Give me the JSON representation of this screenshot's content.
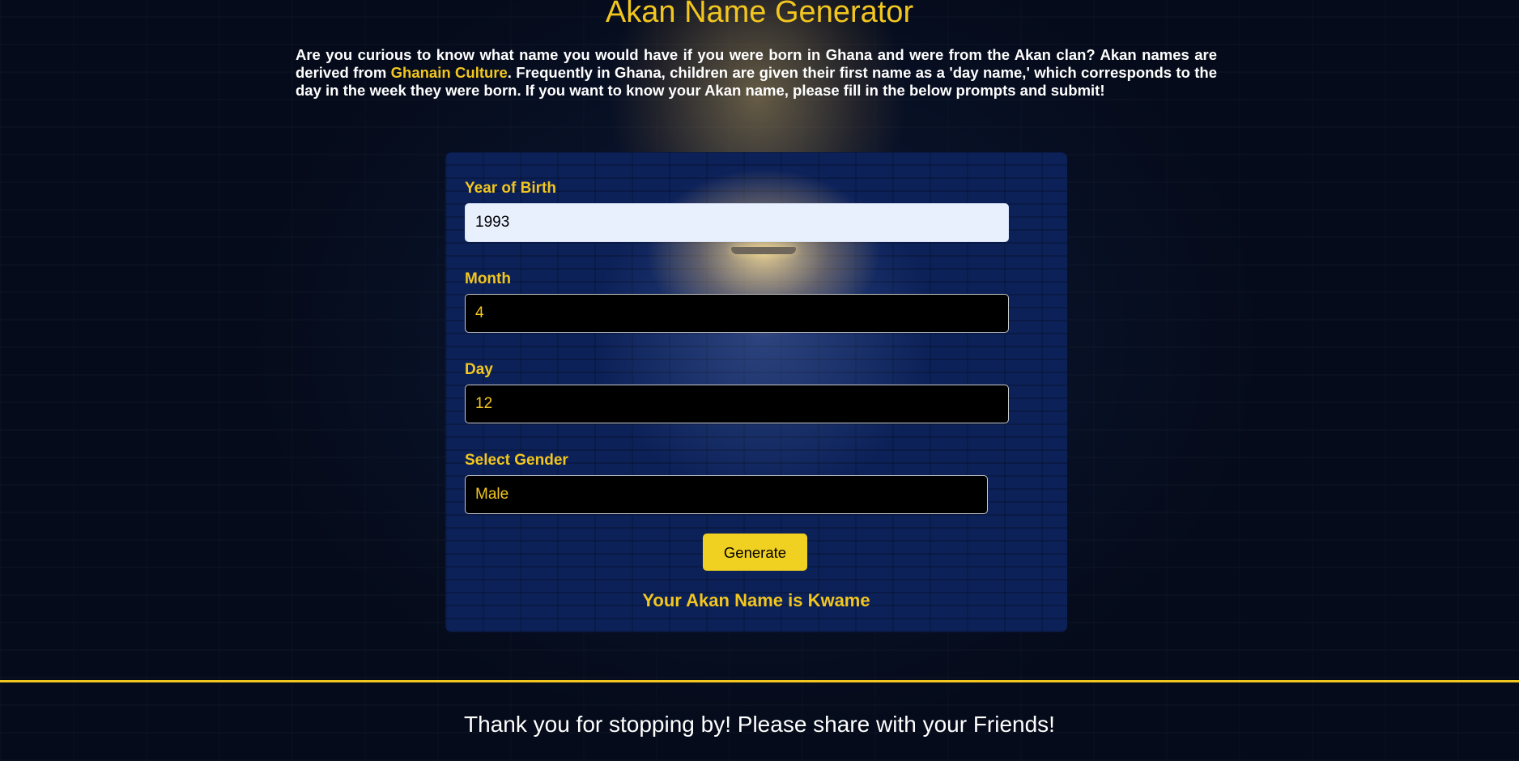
{
  "header": {
    "title": "Akan Name Generator"
  },
  "intro": {
    "text_before": "Are you curious to know what name you would have if you were born in Ghana and were from the Akan clan? Akan names are derived from ",
    "link_text": "Ghanain Culture",
    "text_after": ". Frequently in Ghana, children are given their first name as a 'day name,' which corresponds to the day in the week they were born. If you want to know your Akan name, please fill in the below prompts and submit!"
  },
  "form": {
    "year": {
      "label": "Year of Birth",
      "value": "1993"
    },
    "month": {
      "label": "Month",
      "value": "4"
    },
    "day": {
      "label": "Day",
      "value": "12"
    },
    "gender": {
      "label": "Select Gender",
      "value": "Male"
    },
    "submit_label": "Generate",
    "result_text": "Your Akan Name is Kwame"
  },
  "footer": {
    "text": "Thank you for stopping by! Please share with your Friends!"
  },
  "colors": {
    "accent": "#f2c61f",
    "button": "#f0d020",
    "background": "#050b1a",
    "card": "#0c2158",
    "input_dark": "#000000",
    "input_light": "#e8f0fe"
  }
}
